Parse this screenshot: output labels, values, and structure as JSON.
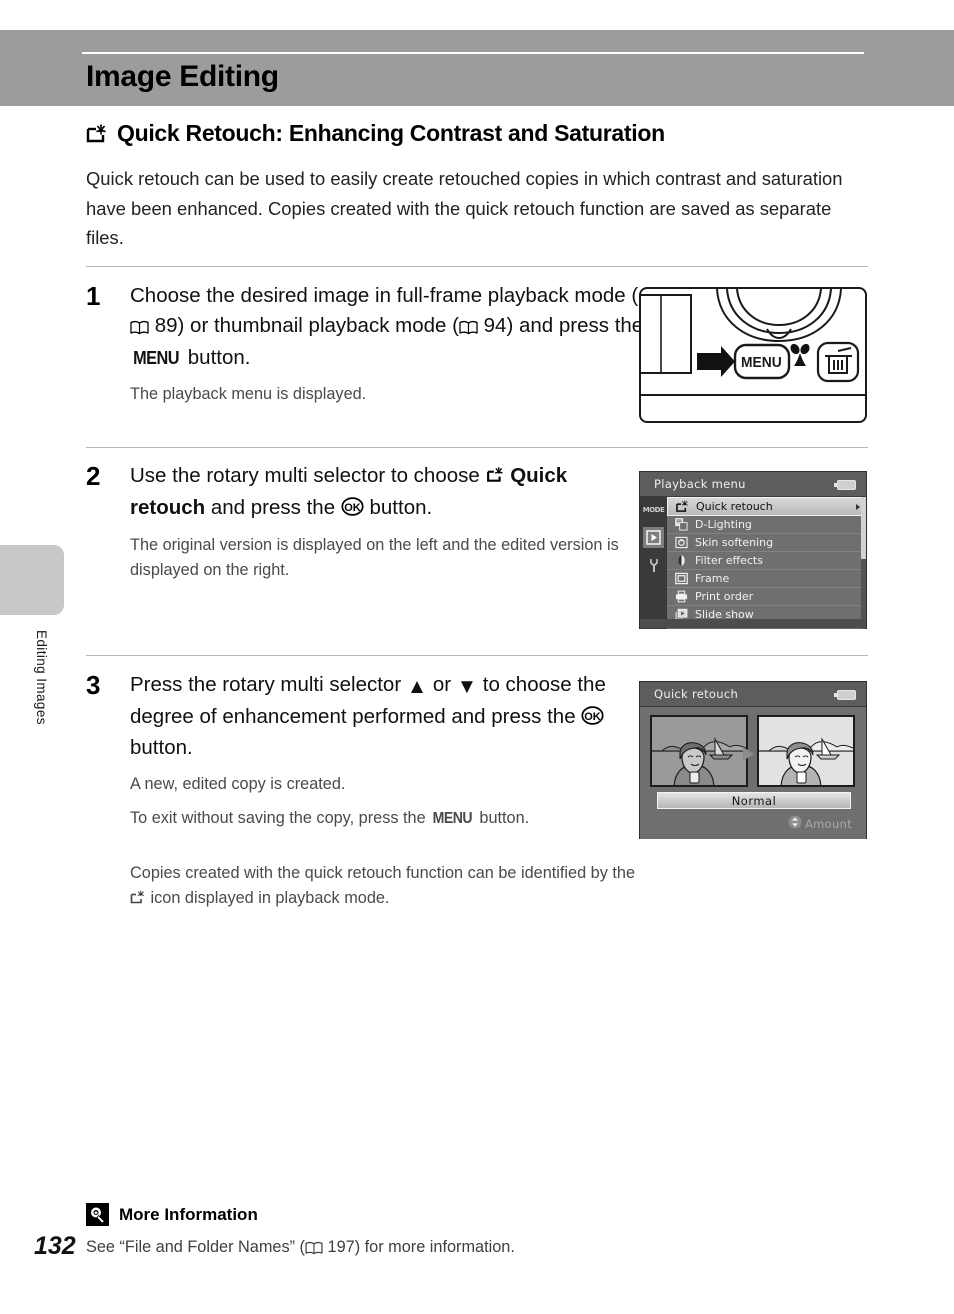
{
  "page": {
    "chapter_title": "Image Editing",
    "page_number": "132",
    "side_tab_label": "Editing Images"
  },
  "section": {
    "icon": "quick-retouch-icon",
    "title": "Quick Retouch: Enhancing Contrast and Saturation",
    "intro": "Quick retouch can be used to easily create retouched copies in which contrast and saturation have been enhanced. Copies created with the quick retouch function are saved as separate files."
  },
  "steps": [
    {
      "number": "1",
      "title_part1": "Choose the desired image in full-frame playback mode (",
      "ref1": "89",
      "title_part2": ") or thumbnail playback mode (",
      "ref2": "94",
      "title_part3": ") and press the ",
      "menu_label": "MENU",
      "title_part4": " button.",
      "note": "The playback menu is displayed."
    },
    {
      "number": "2",
      "title_part1": "Use the rotary multi selector to choose ",
      "bold_item": "Quick retouch",
      "title_part2": " and press the ",
      "ok_label": "OK",
      "title_part3": " button.",
      "note": "The original version is displayed on the left and the edited version is displayed on the right."
    },
    {
      "number": "3",
      "title_part1": "Press the rotary multi selector ",
      "up_glyph": "▲",
      "title_part2": " or ",
      "down_glyph": "▼",
      "title_part3": " to choose the degree of enhancement performed and press the ",
      "ok_label": "OK",
      "title_part4": " button.",
      "note1": "A new, edited copy is created.",
      "note2_part1": "To exit without saving the copy, press the ",
      "note2_menu": "MENU",
      "note2_part2": " button.",
      "note3_part1": "Copies created with the quick retouch function can be identified by the ",
      "note3_part2": " icon displayed in playback mode."
    }
  ],
  "camera_figure": {
    "menu_button_label": "MENU",
    "macro_icon": "macro-flower-icon",
    "delete_icon": "trash-icon",
    "arrow_icon": "right-arrow-icon",
    "dial_icon": "rotary-multi-selector-dial"
  },
  "lcd_playback_menu": {
    "title": "Playback menu",
    "battery_icon": "battery-icon",
    "tabs": [
      {
        "name": "mode-tab",
        "label": "MODE"
      },
      {
        "name": "playback-tab",
        "label": "▶"
      },
      {
        "name": "setup-tab",
        "label": "Y"
      }
    ],
    "items": [
      {
        "label": "Quick retouch",
        "icon": "quick-retouch-icon",
        "selected": true
      },
      {
        "label": "D-Lighting",
        "icon": "d-lighting-icon",
        "selected": false
      },
      {
        "label": "Skin softening",
        "icon": "skin-softening-icon",
        "selected": false
      },
      {
        "label": "Filter effects",
        "icon": "filter-effects-icon",
        "selected": false
      },
      {
        "label": "Frame",
        "icon": "frame-icon",
        "selected": false
      },
      {
        "label": "Print order",
        "icon": "print-order-icon",
        "selected": false
      },
      {
        "label": "Slide show",
        "icon": "slide-show-icon",
        "selected": false
      }
    ]
  },
  "lcd_quick_retouch": {
    "title": "Quick retouch",
    "battery_icon": "battery-icon",
    "option_value": "Normal",
    "amount_label": "Amount",
    "amount_icon": "up-down-selector-icon"
  },
  "footer": {
    "icon": "lightbulb-icon",
    "title": "More Information",
    "text_part1": "See “File and Folder Names” (",
    "ref": "197",
    "text_part2": ") for more information."
  },
  "colors": {
    "title_bar": "#9c9c9c",
    "side_tab": "#c8c8c8",
    "lcd_bg": "#6f6f6f",
    "lcd_header": "#5d5d5d",
    "rule": "#b7b7b7"
  }
}
